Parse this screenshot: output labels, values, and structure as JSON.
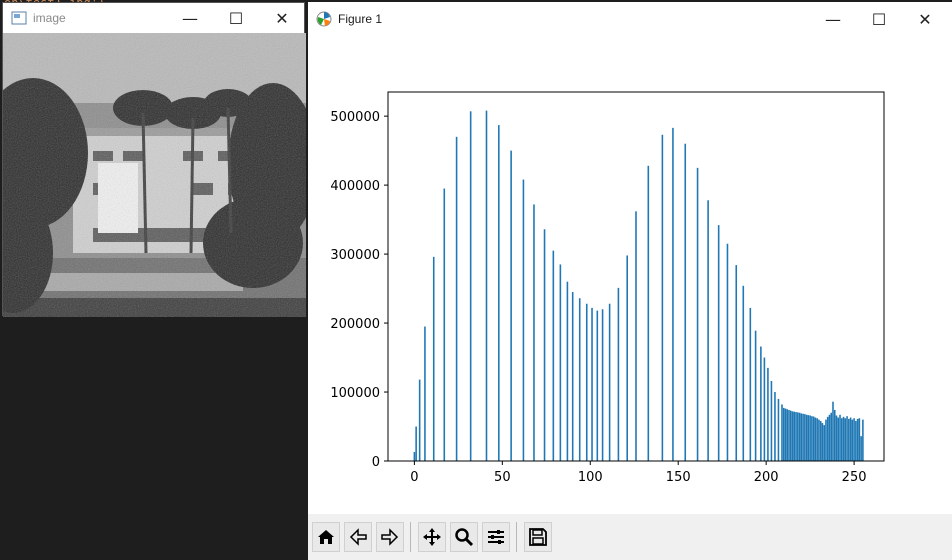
{
  "background_code": "on\\test1.jpg')",
  "image_window": {
    "title": "image",
    "minimize": "—",
    "maximize": "☐",
    "close": "✕",
    "icons": {
      "app": "image-app-icon"
    }
  },
  "figure_window": {
    "title": "Figure 1",
    "minimize": "—",
    "maximize": "☐",
    "close": "✕",
    "icons": {
      "app": "matplotlib-icon"
    },
    "toolbar": {
      "buttons": [
        "home-icon",
        "back-icon",
        "forward-icon",
        "pan-icon",
        "zoom-icon",
        "configure-subplots-icon",
        "save-icon"
      ]
    }
  },
  "chart_data": {
    "type": "bar",
    "xlim": [
      -15,
      267
    ],
    "ylim": [
      0,
      535000
    ],
    "xticks": [
      0,
      50,
      100,
      150,
      200,
      250
    ],
    "yticks": [
      0,
      100000,
      200000,
      300000,
      400000,
      500000
    ],
    "xtick_labels": [
      "0",
      "50",
      "100",
      "150",
      "200",
      "250"
    ],
    "ytick_labels": [
      "0",
      "100000",
      "200000",
      "300000",
      "400000",
      "500000"
    ],
    "bar_color": "#1f77b4",
    "bars": [
      [
        0,
        13000
      ],
      [
        1,
        50000
      ],
      [
        3,
        118000
      ],
      [
        6,
        195000
      ],
      [
        11,
        296000
      ],
      [
        17,
        395000
      ],
      [
        24,
        470000
      ],
      [
        32,
        507000
      ],
      [
        41,
        508000
      ],
      [
        48,
        487000
      ],
      [
        55,
        450000
      ],
      [
        62,
        408000
      ],
      [
        68,
        372000
      ],
      [
        74,
        336000
      ],
      [
        79,
        305000
      ],
      [
        83,
        285000
      ],
      [
        87,
        260000
      ],
      [
        90,
        245000
      ],
      [
        94,
        236000
      ],
      [
        98,
        228000
      ],
      [
        101,
        222000
      ],
      [
        104,
        218000
      ],
      [
        107,
        220000
      ],
      [
        111,
        228000
      ],
      [
        116,
        251000
      ],
      [
        121,
        298000
      ],
      [
        126,
        362000
      ],
      [
        133,
        428000
      ],
      [
        141,
        473000
      ],
      [
        147,
        483000
      ],
      [
        154,
        460000
      ],
      [
        161,
        425000
      ],
      [
        167,
        378000
      ],
      [
        173,
        342000
      ],
      [
        178,
        315000
      ],
      [
        183,
        284000
      ],
      [
        187,
        254000
      ],
      [
        191,
        222000
      ],
      [
        194,
        189000
      ],
      [
        197,
        166000
      ],
      [
        199,
        150000
      ],
      [
        201,
        135000
      ],
      [
        203,
        116000
      ],
      [
        205,
        100000
      ],
      [
        207,
        90000
      ],
      [
        209,
        82000
      ],
      [
        210,
        77000
      ],
      [
        211,
        76000
      ],
      [
        212,
        75000
      ],
      [
        213,
        74000
      ],
      [
        214,
        73000
      ],
      [
        215,
        72000
      ],
      [
        216,
        71500
      ],
      [
        217,
        71000
      ],
      [
        218,
        70500
      ],
      [
        219,
        70000
      ],
      [
        220,
        69000
      ],
      [
        221,
        68500
      ],
      [
        222,
        68000
      ],
      [
        223,
        67000
      ],
      [
        224,
        66500
      ],
      [
        225,
        66000
      ],
      [
        226,
        65000
      ],
      [
        227,
        64500
      ],
      [
        228,
        63000
      ],
      [
        229,
        62000
      ],
      [
        230,
        60000
      ],
      [
        231,
        58000
      ],
      [
        232,
        55000
      ],
      [
        233,
        52000
      ],
      [
        234,
        60000
      ],
      [
        235,
        64000
      ],
      [
        236,
        67000
      ],
      [
        237,
        70000
      ],
      [
        238,
        86000
      ],
      [
        239,
        74000
      ],
      [
        240,
        66000
      ],
      [
        241,
        63000
      ],
      [
        242,
        67000
      ],
      [
        243,
        62000
      ],
      [
        244,
        64000
      ],
      [
        245,
        62000
      ],
      [
        246,
        65000
      ],
      [
        247,
        61000
      ],
      [
        248,
        63000
      ],
      [
        249,
        60000
      ],
      [
        250,
        62000
      ],
      [
        251,
        58000
      ],
      [
        252,
        61000
      ],
      [
        253,
        62000
      ],
      [
        254,
        36000
      ],
      [
        255,
        60000
      ]
    ]
  }
}
